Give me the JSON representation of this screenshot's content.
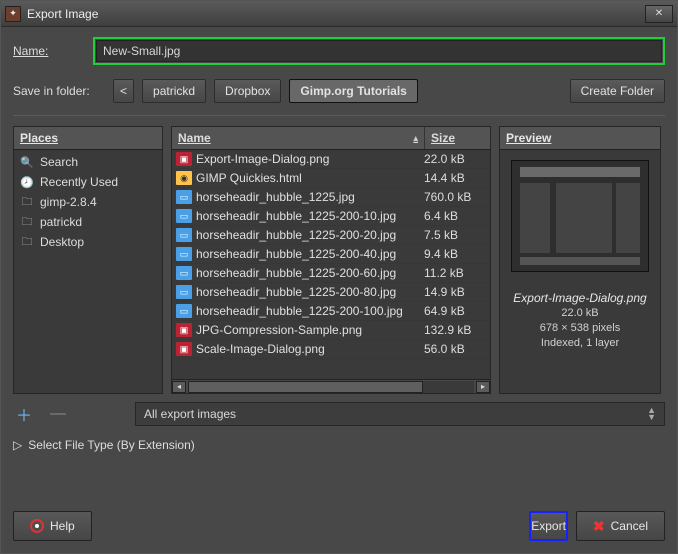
{
  "window": {
    "title": "Export Image"
  },
  "name_row": {
    "label": "Name:",
    "value": "New-Small.jpg"
  },
  "folder_row": {
    "label": "Save in folder:",
    "back": "<",
    "crumbs": [
      "patrickd",
      "Dropbox"
    ],
    "active_crumb": "Gimp.org Tutorials",
    "create_folder": "Create Folder"
  },
  "places": {
    "header": "Places",
    "items": [
      {
        "icon": "search-icon",
        "label": "Search"
      },
      {
        "icon": "recent-icon",
        "label": "Recently Used"
      },
      {
        "icon": "folder-icon",
        "label": "gimp-2.8.4"
      },
      {
        "icon": "folder-icon",
        "label": "patrickd"
      },
      {
        "icon": "folder-icon",
        "label": "Desktop"
      }
    ]
  },
  "files": {
    "col_name": "Name",
    "col_size": "Size",
    "rows": [
      {
        "type": "png",
        "name": "Export-Image-Dialog.png",
        "size": "22.0 kB"
      },
      {
        "type": "html",
        "name": "GIMP Quickies.html",
        "size": "14.4 kB"
      },
      {
        "type": "jpg",
        "name": "horseheadir_hubble_1225.jpg",
        "size": "760.0 kB"
      },
      {
        "type": "jpg",
        "name": "horseheadir_hubble_1225-200-10.jpg",
        "size": "6.4 kB"
      },
      {
        "type": "jpg",
        "name": "horseheadir_hubble_1225-200-20.jpg",
        "size": "7.5 kB"
      },
      {
        "type": "jpg",
        "name": "horseheadir_hubble_1225-200-40.jpg",
        "size": "9.4 kB"
      },
      {
        "type": "jpg",
        "name": "horseheadir_hubble_1225-200-60.jpg",
        "size": "11.2 kB"
      },
      {
        "type": "jpg",
        "name": "horseheadir_hubble_1225-200-80.jpg",
        "size": "14.9 kB"
      },
      {
        "type": "jpg",
        "name": "horseheadir_hubble_1225-200-100.jpg",
        "size": "64.9 kB"
      },
      {
        "type": "png",
        "name": "JPG-Compression-Sample.png",
        "size": "132.9 kB"
      },
      {
        "type": "png",
        "name": "Scale-Image-Dialog.png",
        "size": "56.0 kB"
      }
    ]
  },
  "preview": {
    "header": "Preview",
    "filename": "Export-Image-Dialog.png",
    "size": "22.0 kB",
    "dims": "678 × 538 pixels",
    "mode": "Indexed, 1 layer"
  },
  "filter": {
    "label": "All export images"
  },
  "select_type": {
    "label": "Select File Type (By Extension)"
  },
  "buttons": {
    "help": "Help",
    "export": "Export",
    "cancel": "Cancel"
  }
}
